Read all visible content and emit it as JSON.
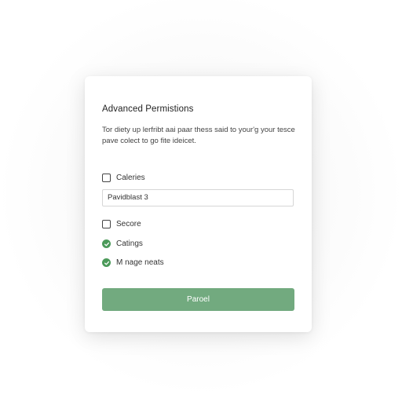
{
  "dialog": {
    "title": "Advanced Permistions",
    "description": "Tor diety up lerfribt aai paar thess said to your'g your tesce pave colect to go fite ideicet."
  },
  "options": [
    {
      "label": "Caleries",
      "state": "unchecked"
    },
    {
      "label": "Secore",
      "state": "unchecked"
    },
    {
      "label": "Catings",
      "state": "checked"
    },
    {
      "label": "M nage neats",
      "state": "checked"
    }
  ],
  "input": {
    "value": "Pavidblast 3"
  },
  "button": {
    "label": "Paroel"
  },
  "colors": {
    "accent": "#72aa7f",
    "check_green": "#4c9a5a"
  },
  "icons": {
    "checked": "check-circle-icon",
    "unchecked": "checkbox-empty-icon"
  }
}
